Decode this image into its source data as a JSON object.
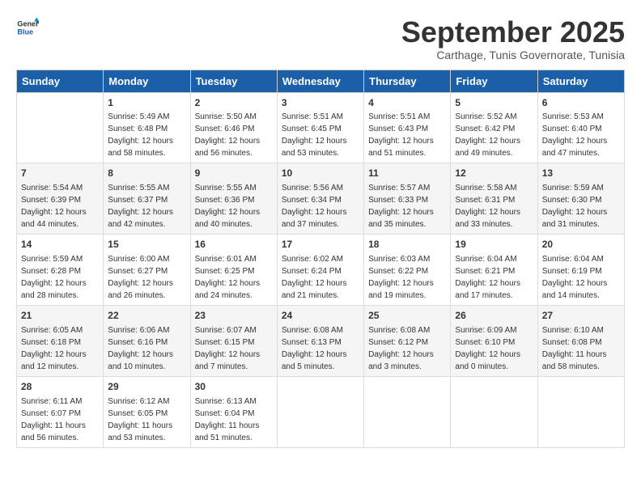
{
  "logo": {
    "line1": "General",
    "line2": "Blue"
  },
  "title": "September 2025",
  "subtitle": "Carthage, Tunis Governorate, Tunisia",
  "weekdays": [
    "Sunday",
    "Monday",
    "Tuesday",
    "Wednesday",
    "Thursday",
    "Friday",
    "Saturday"
  ],
  "weeks": [
    [
      {
        "day": "",
        "info": ""
      },
      {
        "day": "1",
        "info": "Sunrise: 5:49 AM\nSunset: 6:48 PM\nDaylight: 12 hours\nand 58 minutes."
      },
      {
        "day": "2",
        "info": "Sunrise: 5:50 AM\nSunset: 6:46 PM\nDaylight: 12 hours\nand 56 minutes."
      },
      {
        "day": "3",
        "info": "Sunrise: 5:51 AM\nSunset: 6:45 PM\nDaylight: 12 hours\nand 53 minutes."
      },
      {
        "day": "4",
        "info": "Sunrise: 5:51 AM\nSunset: 6:43 PM\nDaylight: 12 hours\nand 51 minutes."
      },
      {
        "day": "5",
        "info": "Sunrise: 5:52 AM\nSunset: 6:42 PM\nDaylight: 12 hours\nand 49 minutes."
      },
      {
        "day": "6",
        "info": "Sunrise: 5:53 AM\nSunset: 6:40 PM\nDaylight: 12 hours\nand 47 minutes."
      }
    ],
    [
      {
        "day": "7",
        "info": "Sunrise: 5:54 AM\nSunset: 6:39 PM\nDaylight: 12 hours\nand 44 minutes."
      },
      {
        "day": "8",
        "info": "Sunrise: 5:55 AM\nSunset: 6:37 PM\nDaylight: 12 hours\nand 42 minutes."
      },
      {
        "day": "9",
        "info": "Sunrise: 5:55 AM\nSunset: 6:36 PM\nDaylight: 12 hours\nand 40 minutes."
      },
      {
        "day": "10",
        "info": "Sunrise: 5:56 AM\nSunset: 6:34 PM\nDaylight: 12 hours\nand 37 minutes."
      },
      {
        "day": "11",
        "info": "Sunrise: 5:57 AM\nSunset: 6:33 PM\nDaylight: 12 hours\nand 35 minutes."
      },
      {
        "day": "12",
        "info": "Sunrise: 5:58 AM\nSunset: 6:31 PM\nDaylight: 12 hours\nand 33 minutes."
      },
      {
        "day": "13",
        "info": "Sunrise: 5:59 AM\nSunset: 6:30 PM\nDaylight: 12 hours\nand 31 minutes."
      }
    ],
    [
      {
        "day": "14",
        "info": "Sunrise: 5:59 AM\nSunset: 6:28 PM\nDaylight: 12 hours\nand 28 minutes."
      },
      {
        "day": "15",
        "info": "Sunrise: 6:00 AM\nSunset: 6:27 PM\nDaylight: 12 hours\nand 26 minutes."
      },
      {
        "day": "16",
        "info": "Sunrise: 6:01 AM\nSunset: 6:25 PM\nDaylight: 12 hours\nand 24 minutes."
      },
      {
        "day": "17",
        "info": "Sunrise: 6:02 AM\nSunset: 6:24 PM\nDaylight: 12 hours\nand 21 minutes."
      },
      {
        "day": "18",
        "info": "Sunrise: 6:03 AM\nSunset: 6:22 PM\nDaylight: 12 hours\nand 19 minutes."
      },
      {
        "day": "19",
        "info": "Sunrise: 6:04 AM\nSunset: 6:21 PM\nDaylight: 12 hours\nand 17 minutes."
      },
      {
        "day": "20",
        "info": "Sunrise: 6:04 AM\nSunset: 6:19 PM\nDaylight: 12 hours\nand 14 minutes."
      }
    ],
    [
      {
        "day": "21",
        "info": "Sunrise: 6:05 AM\nSunset: 6:18 PM\nDaylight: 12 hours\nand 12 minutes."
      },
      {
        "day": "22",
        "info": "Sunrise: 6:06 AM\nSunset: 6:16 PM\nDaylight: 12 hours\nand 10 minutes."
      },
      {
        "day": "23",
        "info": "Sunrise: 6:07 AM\nSunset: 6:15 PM\nDaylight: 12 hours\nand 7 minutes."
      },
      {
        "day": "24",
        "info": "Sunrise: 6:08 AM\nSunset: 6:13 PM\nDaylight: 12 hours\nand 5 minutes."
      },
      {
        "day": "25",
        "info": "Sunrise: 6:08 AM\nSunset: 6:12 PM\nDaylight: 12 hours\nand 3 minutes."
      },
      {
        "day": "26",
        "info": "Sunrise: 6:09 AM\nSunset: 6:10 PM\nDaylight: 12 hours\nand 0 minutes."
      },
      {
        "day": "27",
        "info": "Sunrise: 6:10 AM\nSunset: 6:08 PM\nDaylight: 11 hours\nand 58 minutes."
      }
    ],
    [
      {
        "day": "28",
        "info": "Sunrise: 6:11 AM\nSunset: 6:07 PM\nDaylight: 11 hours\nand 56 minutes."
      },
      {
        "day": "29",
        "info": "Sunrise: 6:12 AM\nSunset: 6:05 PM\nDaylight: 11 hours\nand 53 minutes."
      },
      {
        "day": "30",
        "info": "Sunrise: 6:13 AM\nSunset: 6:04 PM\nDaylight: 11 hours\nand 51 minutes."
      },
      {
        "day": "",
        "info": ""
      },
      {
        "day": "",
        "info": ""
      },
      {
        "day": "",
        "info": ""
      },
      {
        "day": "",
        "info": ""
      }
    ]
  ]
}
